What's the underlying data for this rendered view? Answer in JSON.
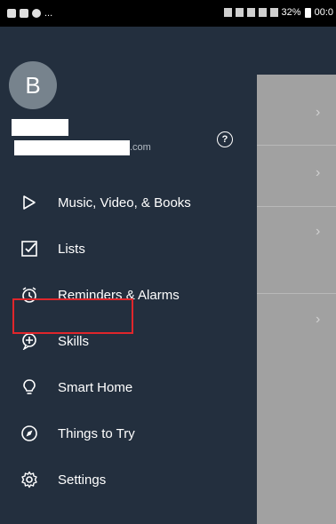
{
  "status_bar": {
    "left_text": "...",
    "right_text": "32%",
    "time": "00:0"
  },
  "profile": {
    "avatar_letter": "B",
    "email_suffix": ".com",
    "help_label": "?"
  },
  "menu": {
    "items": [
      {
        "label": "Music, Video, & Books",
        "icon": "play-icon"
      },
      {
        "label": "Lists",
        "icon": "checklist-icon"
      },
      {
        "label": "Reminders & Alarms",
        "icon": "alarm-clock-icon"
      },
      {
        "label": "Skills",
        "icon": "skills-icon"
      },
      {
        "label": "Smart Home",
        "icon": "lightbulb-icon"
      },
      {
        "label": "Things to Try",
        "icon": "compass-icon"
      },
      {
        "label": "Settings",
        "icon": "gear-icon"
      }
    ],
    "highlighted_item": "Skills"
  },
  "background_list": {
    "chevron": "›"
  },
  "colors": {
    "drawer_bg": "#232f3e",
    "highlight": "#e0262b",
    "overlay": "#a1a1a1"
  }
}
